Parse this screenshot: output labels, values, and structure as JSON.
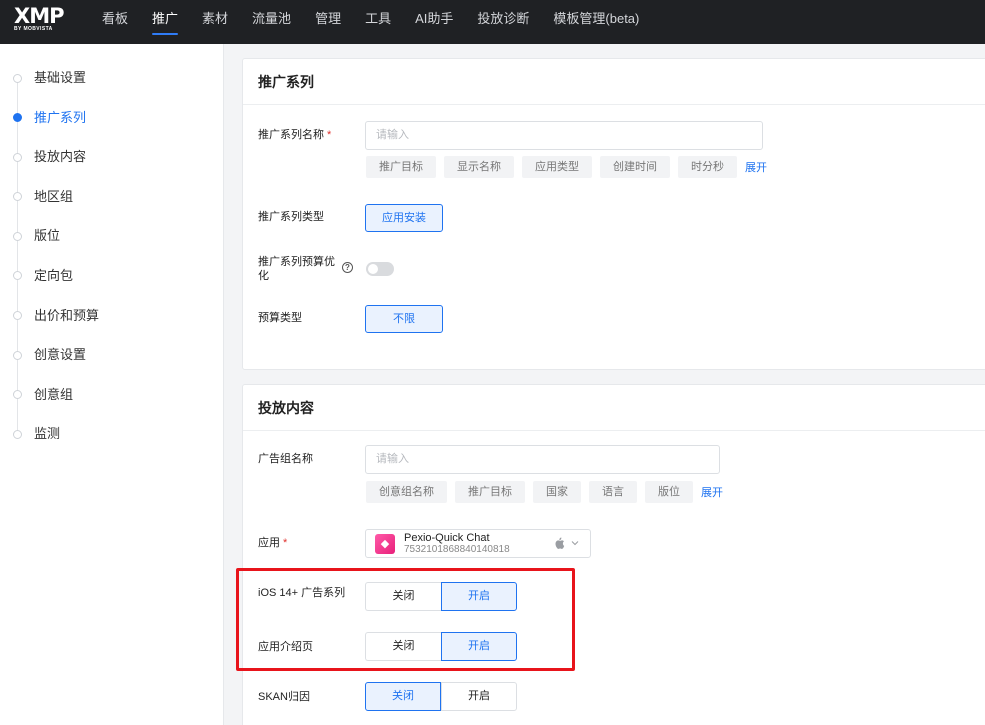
{
  "nav": {
    "logo_text": "XMP",
    "logo_sub": "BY MOBVISTA",
    "items": [
      "看板",
      "推广",
      "素材",
      "流量池",
      "管理",
      "工具",
      "AI助手",
      "投放诊断",
      "模板管理(beta)"
    ]
  },
  "sidebar": {
    "steps": [
      "基础设置",
      "推广系列",
      "投放内容",
      "地区组",
      "版位",
      "定向包",
      "出价和预算",
      "创意设置",
      "创意组",
      "监测"
    ]
  },
  "campaign": {
    "title": "推广系列",
    "name_label": "推广系列名称",
    "required_mark": "*",
    "name_placeholder": "请输入",
    "name_tags": [
      "推广目标",
      "显示名称",
      "应用类型",
      "创建时间",
      "时分秒"
    ],
    "expand": "展开",
    "type_label": "推广系列类型",
    "type_value": "应用安装",
    "budget_opt_label_1": "推广系列预算优",
    "budget_opt_label_2": "化",
    "help_glyph": "?",
    "budget_type_label": "预算类型",
    "budget_type_value": "不限"
  },
  "content": {
    "title": "投放内容",
    "adgroup_label": "广告组名称",
    "adgroup_placeholder": "请输入",
    "adgroup_tags": [
      "创意组名称",
      "推广目标",
      "国家",
      "语言",
      "版位"
    ],
    "expand": "展开",
    "app_label": "应用",
    "required_mark": "*",
    "app_name": "Pexio-Quick Chat",
    "app_id": "7532101868840140818",
    "ios14_label": "iOS 14+ 广告系列",
    "app_page_label": "应用介绍页",
    "skan_label": "SKAN归因",
    "off": "关闭",
    "on": "开启"
  }
}
